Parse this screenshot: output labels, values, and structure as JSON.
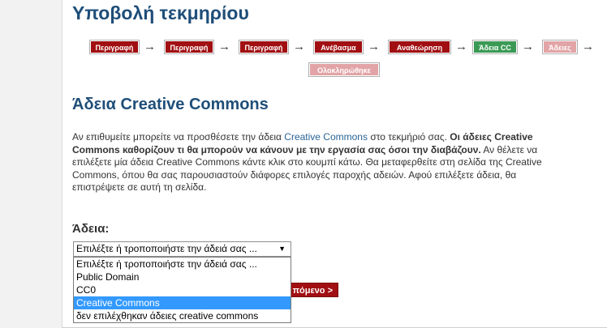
{
  "page": {
    "title": "Υποβολή τεκμηρίου"
  },
  "steps": [
    {
      "label": "Περιγραφή",
      "state": "done"
    },
    {
      "label": "Περιγραφή",
      "state": "done"
    },
    {
      "label": "Περιγραφή",
      "state": "done"
    },
    {
      "label": "Ανέβασμα",
      "state": "done"
    },
    {
      "label": "Αναθεώρηση",
      "state": "done"
    },
    {
      "label": "Άδεια CC",
      "state": "current"
    },
    {
      "label": "Άδειες",
      "state": "pending"
    },
    {
      "label": "Ολοκληρώθηκε",
      "state": "pending"
    }
  ],
  "arrow_glyph": "→",
  "section": {
    "heading": "Άδεια Creative Commons",
    "intro_part1": "Αν επιθυμείτε μπορείτε να προσθέσετε την άδεια ",
    "intro_link": "Creative Commons",
    "intro_part2": " στο τεκμήριό σας. ",
    "intro_bold": "Οι άδειες Creative Commons καθορίζουν τι θα μπορούν να κάνουν με την εργασία σας όσοι την διαβάζουν.",
    "intro_part3": " Αν θέλετε να επιλέξετε μία άδεια Creative Commons κάντε κλικ στο κουμπί κάτω. Θα μεταφερθείτε στη σελίδα της Creative Commons, όπου θα σας παρουσιαστούν διάφορες επιλογές παροχής αδειών. Αφού επιλέξετε άδεια, θα επιστρέψετε σε αυτή τη σελίδα."
  },
  "license_field": {
    "label": "Άδεια:",
    "selected": "Επιλέξτε ή τροποποιήστε την άδειά σας ...",
    "caret": "▼",
    "options": [
      "Επιλέξτε ή τροποποιήστε την άδειά σας ...",
      "Public Domain",
      "CC0",
      "Creative Commons",
      "δεν επιλέχθηκαν άδειες creative commons"
    ],
    "highlighted_index": 3
  },
  "next_button": {
    "label": "πόμενο >"
  },
  "colors": {
    "heading": "#1f4e79",
    "step_done": "#a10f12",
    "step_current": "#3a9a55",
    "step_pending": "#e2a4a6",
    "link": "#2a6496",
    "highlight": "#3399ff"
  }
}
